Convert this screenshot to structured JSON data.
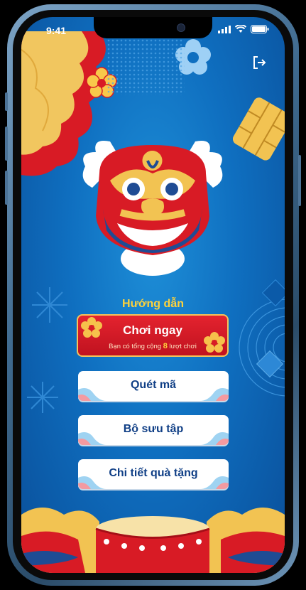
{
  "status_bar": {
    "time": "9:41"
  },
  "header": {
    "exit_icon": "logout-icon"
  },
  "guide": {
    "label": "Hướng dẫn"
  },
  "play": {
    "title": "Chơi ngay",
    "sub_prefix": "Bạn có tổng cộng",
    "count": "8",
    "sub_suffix": "lượt chơi"
  },
  "menu": {
    "scan": "Quét mã",
    "collection": "Bộ sưu tập",
    "gifts": "Chi tiết quà tặng"
  },
  "colors": {
    "accent": "#ffd23b",
    "primary": "#103f86",
    "red": "#d81b25"
  }
}
